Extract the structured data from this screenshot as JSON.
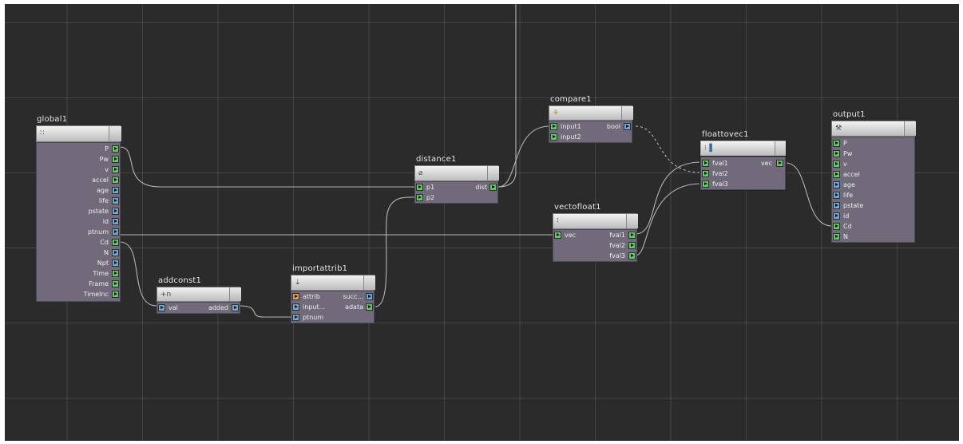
{
  "colors": {
    "background": "#2b2b2b",
    "node_body": "#716a7a",
    "port_green": "#66c86a",
    "port_blue": "#6fa7d6",
    "port_orange": "#e49a5b",
    "wire": "#b5b5b5"
  },
  "nodes": {
    "global1": {
      "title": "global1",
      "icon": "grid-dots-icon",
      "outputs": [
        "P",
        "Pw",
        "v",
        "accel",
        "age",
        "life",
        "pstate",
        "id",
        "ptnum",
        "Cd",
        "N",
        "Npt",
        "Time",
        "Frame",
        "TimeInc"
      ]
    },
    "addconst1": {
      "title": "addconst1",
      "icon": "plus-n-icon",
      "icon_text": "+n",
      "inputs": [
        "val"
      ],
      "outputs": [
        "added"
      ]
    },
    "importattrib1": {
      "title": "importattrib1",
      "icon": "import-icon",
      "inputs": [
        "attrib",
        "input...",
        "ptnum"
      ],
      "outputs": [
        "succ...",
        "adata"
      ]
    },
    "distance1": {
      "title": "distance1",
      "icon": "distance-icon",
      "inputs": [
        "p1",
        "p2"
      ],
      "outputs": [
        "dist"
      ]
    },
    "compare1": {
      "title": "compare1",
      "icon": "compare-icon",
      "inputs": [
        "input1",
        "input2"
      ],
      "outputs": [
        "bool"
      ]
    },
    "vectofloat1": {
      "title": "vectofloat1",
      "icon": "split-icon",
      "inputs": [
        "vec"
      ],
      "outputs": [
        "fval1",
        "fval2",
        "fval3"
      ]
    },
    "floattovec1": {
      "title": "floattovec1",
      "icon": "merge-icon",
      "inputs": [
        "fval1",
        "fval2",
        "fval3"
      ],
      "outputs": [
        "vec"
      ]
    },
    "output1": {
      "title": "output1",
      "icon": "output-icon",
      "inputs": [
        "P",
        "Pw",
        "v",
        "accel",
        "age",
        "life",
        "pstate",
        "id",
        "Cd",
        "N"
      ]
    }
  }
}
